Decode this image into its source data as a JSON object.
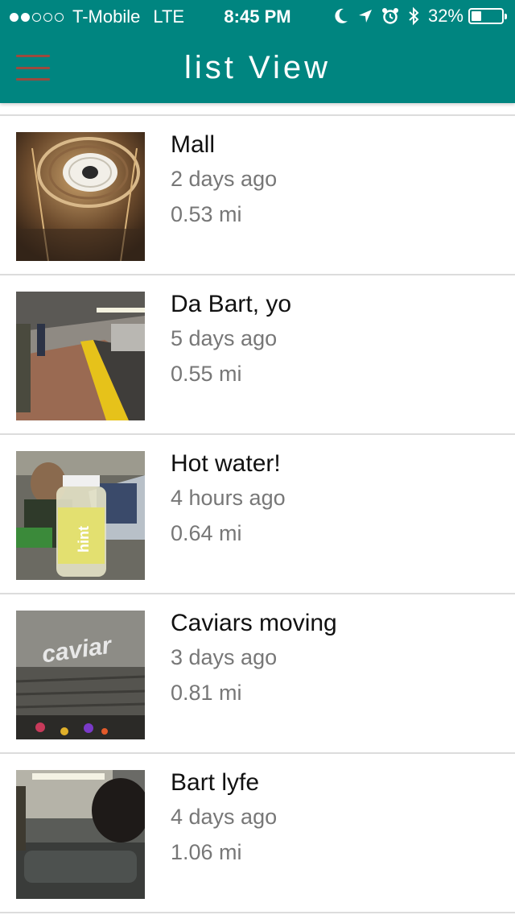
{
  "status_bar": {
    "signal_dots": [
      "full",
      "full",
      "empty",
      "empty",
      "empty"
    ],
    "carrier": "T-Mobile",
    "network": "LTE",
    "time": "8:45 PM",
    "icons": [
      "moon-icon",
      "location-arrow-icon",
      "alarm-icon",
      "bluetooth-icon"
    ],
    "battery_percent": "32%",
    "battery_level": 0.32
  },
  "header": {
    "title": "list View",
    "background_color": "#008580",
    "menu_icon_color": "#9b4a3e"
  },
  "items": [
    {
      "title": "Mall",
      "time": "2 days ago",
      "distance": "0.53 mi"
    },
    {
      "title": "Da Bart, yo",
      "time": "5 days ago",
      "distance": "0.55 mi"
    },
    {
      "title": "Hot water!",
      "time": "4 hours ago",
      "distance": "0.64 mi"
    },
    {
      "title": "Caviars moving",
      "time": "3 days ago",
      "distance": "0.81 mi",
      "thumb_text": "caviar"
    },
    {
      "title": "Bart lyfe",
      "time": "4 days ago",
      "distance": "1.06 mi"
    }
  ]
}
